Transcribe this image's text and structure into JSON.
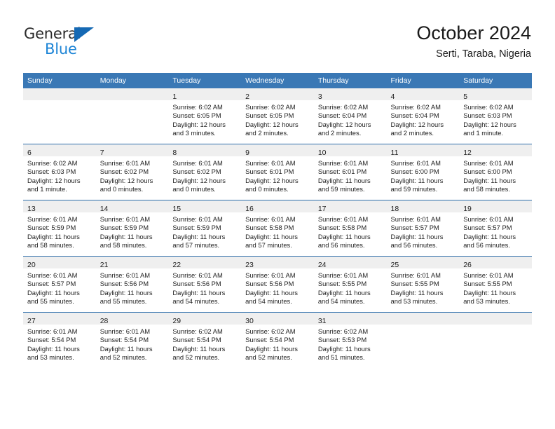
{
  "brand": {
    "name_primary": "General",
    "name_secondary": "Blue",
    "triangle_icon": "triangle-icon",
    "accent_color": "#1c84d6",
    "primary_color": "#2b2b2b"
  },
  "header": {
    "title": "October 2024",
    "subtitle": "Serti, Taraba, Nigeria"
  },
  "theme": {
    "header_row_bg": "#3a78b5",
    "daynum_band_bg": "#efefef",
    "row_divider": "#2f6fab",
    "cell_bg": "#ffffff"
  },
  "weekday_headers": [
    "Sunday",
    "Monday",
    "Tuesday",
    "Wednesday",
    "Thursday",
    "Friday",
    "Saturday"
  ],
  "weeks": [
    [
      {
        "day": "",
        "lines": []
      },
      {
        "day": "",
        "lines": []
      },
      {
        "day": "1",
        "lines": [
          "Sunrise: 6:02 AM",
          "Sunset: 6:05 PM",
          "Daylight: 12 hours",
          "and 3 minutes."
        ]
      },
      {
        "day": "2",
        "lines": [
          "Sunrise: 6:02 AM",
          "Sunset: 6:05 PM",
          "Daylight: 12 hours",
          "and 2 minutes."
        ]
      },
      {
        "day": "3",
        "lines": [
          "Sunrise: 6:02 AM",
          "Sunset: 6:04 PM",
          "Daylight: 12 hours",
          "and 2 minutes."
        ]
      },
      {
        "day": "4",
        "lines": [
          "Sunrise: 6:02 AM",
          "Sunset: 6:04 PM",
          "Daylight: 12 hours",
          "and 2 minutes."
        ]
      },
      {
        "day": "5",
        "lines": [
          "Sunrise: 6:02 AM",
          "Sunset: 6:03 PM",
          "Daylight: 12 hours",
          "and 1 minute."
        ]
      }
    ],
    [
      {
        "day": "6",
        "lines": [
          "Sunrise: 6:02 AM",
          "Sunset: 6:03 PM",
          "Daylight: 12 hours",
          "and 1 minute."
        ]
      },
      {
        "day": "7",
        "lines": [
          "Sunrise: 6:01 AM",
          "Sunset: 6:02 PM",
          "Daylight: 12 hours",
          "and 0 minutes."
        ]
      },
      {
        "day": "8",
        "lines": [
          "Sunrise: 6:01 AM",
          "Sunset: 6:02 PM",
          "Daylight: 12 hours",
          "and 0 minutes."
        ]
      },
      {
        "day": "9",
        "lines": [
          "Sunrise: 6:01 AM",
          "Sunset: 6:01 PM",
          "Daylight: 12 hours",
          "and 0 minutes."
        ]
      },
      {
        "day": "10",
        "lines": [
          "Sunrise: 6:01 AM",
          "Sunset: 6:01 PM",
          "Daylight: 11 hours",
          "and 59 minutes."
        ]
      },
      {
        "day": "11",
        "lines": [
          "Sunrise: 6:01 AM",
          "Sunset: 6:00 PM",
          "Daylight: 11 hours",
          "and 59 minutes."
        ]
      },
      {
        "day": "12",
        "lines": [
          "Sunrise: 6:01 AM",
          "Sunset: 6:00 PM",
          "Daylight: 11 hours",
          "and 58 minutes."
        ]
      }
    ],
    [
      {
        "day": "13",
        "lines": [
          "Sunrise: 6:01 AM",
          "Sunset: 5:59 PM",
          "Daylight: 11 hours",
          "and 58 minutes."
        ]
      },
      {
        "day": "14",
        "lines": [
          "Sunrise: 6:01 AM",
          "Sunset: 5:59 PM",
          "Daylight: 11 hours",
          "and 58 minutes."
        ]
      },
      {
        "day": "15",
        "lines": [
          "Sunrise: 6:01 AM",
          "Sunset: 5:59 PM",
          "Daylight: 11 hours",
          "and 57 minutes."
        ]
      },
      {
        "day": "16",
        "lines": [
          "Sunrise: 6:01 AM",
          "Sunset: 5:58 PM",
          "Daylight: 11 hours",
          "and 57 minutes."
        ]
      },
      {
        "day": "17",
        "lines": [
          "Sunrise: 6:01 AM",
          "Sunset: 5:58 PM",
          "Daylight: 11 hours",
          "and 56 minutes."
        ]
      },
      {
        "day": "18",
        "lines": [
          "Sunrise: 6:01 AM",
          "Sunset: 5:57 PM",
          "Daylight: 11 hours",
          "and 56 minutes."
        ]
      },
      {
        "day": "19",
        "lines": [
          "Sunrise: 6:01 AM",
          "Sunset: 5:57 PM",
          "Daylight: 11 hours",
          "and 56 minutes."
        ]
      }
    ],
    [
      {
        "day": "20",
        "lines": [
          "Sunrise: 6:01 AM",
          "Sunset: 5:57 PM",
          "Daylight: 11 hours",
          "and 55 minutes."
        ]
      },
      {
        "day": "21",
        "lines": [
          "Sunrise: 6:01 AM",
          "Sunset: 5:56 PM",
          "Daylight: 11 hours",
          "and 55 minutes."
        ]
      },
      {
        "day": "22",
        "lines": [
          "Sunrise: 6:01 AM",
          "Sunset: 5:56 PM",
          "Daylight: 11 hours",
          "and 54 minutes."
        ]
      },
      {
        "day": "23",
        "lines": [
          "Sunrise: 6:01 AM",
          "Sunset: 5:56 PM",
          "Daylight: 11 hours",
          "and 54 minutes."
        ]
      },
      {
        "day": "24",
        "lines": [
          "Sunrise: 6:01 AM",
          "Sunset: 5:55 PM",
          "Daylight: 11 hours",
          "and 54 minutes."
        ]
      },
      {
        "day": "25",
        "lines": [
          "Sunrise: 6:01 AM",
          "Sunset: 5:55 PM",
          "Daylight: 11 hours",
          "and 53 minutes."
        ]
      },
      {
        "day": "26",
        "lines": [
          "Sunrise: 6:01 AM",
          "Sunset: 5:55 PM",
          "Daylight: 11 hours",
          "and 53 minutes."
        ]
      }
    ],
    [
      {
        "day": "27",
        "lines": [
          "Sunrise: 6:01 AM",
          "Sunset: 5:54 PM",
          "Daylight: 11 hours",
          "and 53 minutes."
        ]
      },
      {
        "day": "28",
        "lines": [
          "Sunrise: 6:01 AM",
          "Sunset: 5:54 PM",
          "Daylight: 11 hours",
          "and 52 minutes."
        ]
      },
      {
        "day": "29",
        "lines": [
          "Sunrise: 6:02 AM",
          "Sunset: 5:54 PM",
          "Daylight: 11 hours",
          "and 52 minutes."
        ]
      },
      {
        "day": "30",
        "lines": [
          "Sunrise: 6:02 AM",
          "Sunset: 5:54 PM",
          "Daylight: 11 hours",
          "and 52 minutes."
        ]
      },
      {
        "day": "31",
        "lines": [
          "Sunrise: 6:02 AM",
          "Sunset: 5:53 PM",
          "Daylight: 11 hours",
          "and 51 minutes."
        ]
      },
      {
        "day": "",
        "lines": []
      },
      {
        "day": "",
        "lines": []
      }
    ]
  ]
}
